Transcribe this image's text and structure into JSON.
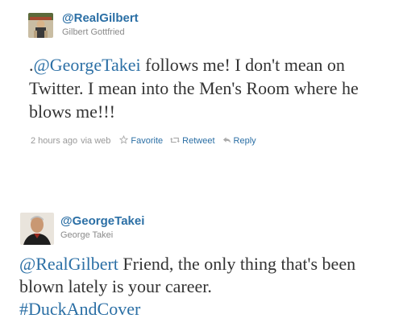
{
  "tweets": [
    {
      "handle": "@RealGilbert",
      "display_name": "Gilbert Gottfried",
      "text_prefix": ".",
      "mention": "@GeorgeTakei",
      "text_body": " follows me! I don't mean on Twitter. I mean into the Men's Room where he blows me!!!",
      "timestamp": "2 hours ago",
      "via": "via web",
      "actions": {
        "favorite": "Favorite",
        "retweet": "Retweet",
        "reply": "Reply"
      },
      "icons": [
        "star-icon",
        "retweet-icon",
        "reply-icon"
      ]
    },
    {
      "handle": "@GeorgeTakei",
      "display_name": "George Takei",
      "mention": "@RealGilbert",
      "text_body": " Friend, the only thing that's been blown lately is your career.",
      "hashtag": "#DuckAndCover"
    }
  ],
  "colors": {
    "link": "#2b6fa5",
    "text": "#333333",
    "meta": "#999999"
  }
}
